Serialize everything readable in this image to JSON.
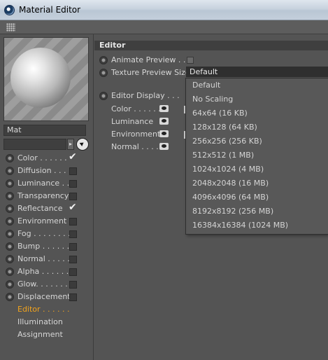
{
  "window": {
    "title": "Material Editor"
  },
  "material": {
    "name": "Mat"
  },
  "channels": [
    {
      "label": "Color . . . . . .",
      "state": "checked"
    },
    {
      "label": "Diffusion . . .",
      "state": "unchecked"
    },
    {
      "label": "Luminance . .",
      "state": "unchecked"
    },
    {
      "label": "Transparency",
      "state": "unchecked"
    },
    {
      "label": "Reflectance",
      "state": "checked"
    },
    {
      "label": "Environment",
      "state": "unchecked"
    },
    {
      "label": "Fog . . . . . . . .",
      "state": "unchecked"
    },
    {
      "label": "Bump . . . . . .",
      "state": "unchecked"
    },
    {
      "label": "Normal . . . . .",
      "state": "unchecked"
    },
    {
      "label": "Alpha . . . . . .",
      "state": "unchecked"
    },
    {
      "label": "Glow. . . . . . .",
      "state": "unchecked"
    },
    {
      "label": "Displacement",
      "state": "unchecked"
    }
  ],
  "pages": [
    {
      "label": "Editor . . . . . .",
      "active": true
    },
    {
      "label": "Illumination",
      "active": false
    },
    {
      "label": "Assignment",
      "active": false
    }
  ],
  "editor": {
    "header": "Editor",
    "animate_preview": "Animate Preview . . .",
    "texture_preview_size": "Texture Preview Size",
    "texture_preview_value": "Default",
    "editor_display": "Editor Display . . .",
    "display_rows": [
      {
        "label": "Color . . . . . ."
      },
      {
        "label": "Luminance"
      },
      {
        "label": "Environment"
      },
      {
        "label": "Normal . . . . ."
      }
    ]
  },
  "menu": {
    "options": [
      "Default",
      "No Scaling",
      "64x64 (16 KB)",
      "128x128 (64 KB)",
      "256x256 (256 KB)",
      "512x512 (1 MB)",
      "1024x1024 (4 MB)",
      "2048x2048 (16 MB)",
      "4096x4096 (64 MB)",
      "8192x8192 (256 MB)",
      "16384x16384 (1024 MB)"
    ]
  },
  "colors": {
    "background": "#545454",
    "active_page": "#f2a31c",
    "field": "#3f3f3f",
    "titlebar": "#c7d2de"
  }
}
